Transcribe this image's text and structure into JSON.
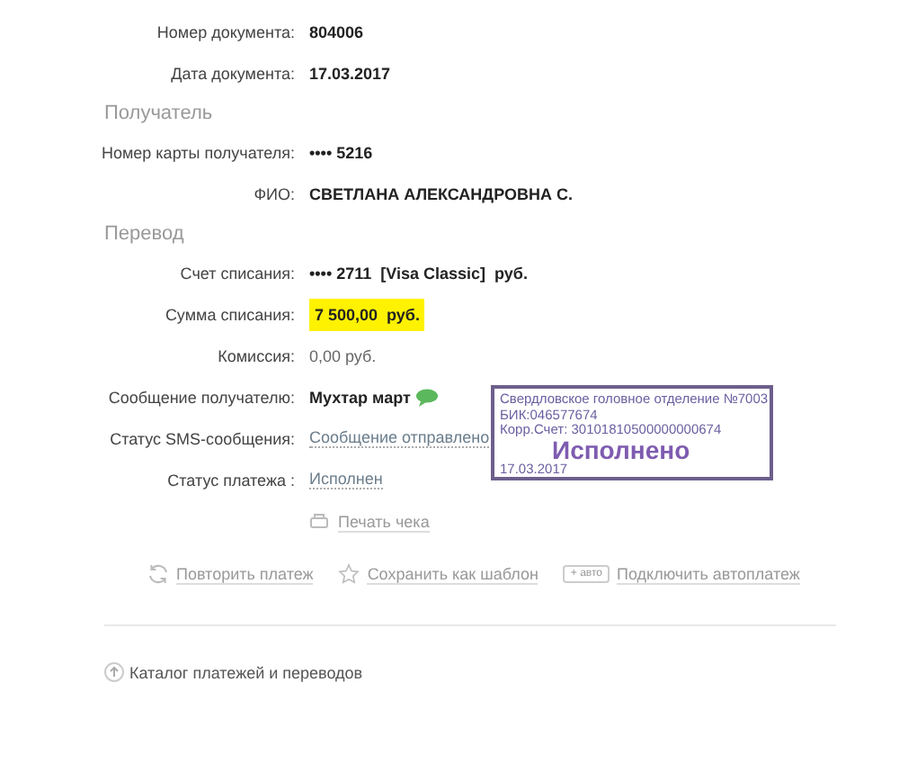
{
  "document": [
    {
      "label": "Номер документа:",
      "value": "804006",
      "kind": "bold"
    },
    {
      "label": "Дата документа:",
      "value": "17.03.2017",
      "kind": "bold"
    }
  ],
  "sections": [
    {
      "title": "Получатель",
      "rows": [
        {
          "label": "Номер карты получателя:",
          "value": "•••• 5216",
          "kind": "bold"
        },
        {
          "label": "ФИО:",
          "value": "СВЕТЛАНА АЛЕКСАНДРОВНА С.",
          "kind": "bold"
        }
      ]
    },
    {
      "title": "Перевод",
      "rows": [
        {
          "label": "Счет списания:",
          "value": "•••• 2711  [Visa Classic]  руб.",
          "kind": "bold"
        },
        {
          "label": "Сумма списания:",
          "value": "7 500,00  руб.",
          "kind": "highlight"
        },
        {
          "label": "Комиссия:",
          "value": "0,00 руб.",
          "kind": "plain"
        },
        {
          "label": "Сообщение получателю:",
          "value": "Мухтар март",
          "kind": "message"
        },
        {
          "label": "Статус SMS-сообщения:",
          "value": "Сообщение отправлено",
          "kind": "link"
        },
        {
          "label": "Статус платежа :",
          "value": "Исполнен",
          "kind": "link"
        }
      ]
    }
  ],
  "print": "Печать чека",
  "actions": [
    {
      "label": "Повторить платеж",
      "kind": "repeat"
    },
    {
      "label": "Сохранить как шаблон",
      "kind": "star"
    },
    {
      "label": "Подключить автоплатеж",
      "kind": "auto",
      "badge": "+ авто"
    }
  ],
  "stamp": {
    "lines": [
      "Свердловское головное отделение №7003",
      "БИК:046577674",
      "Корр.Счет: 30101810500000000674"
    ],
    "status": "Исполнено",
    "date": "17.03.2017"
  },
  "catalog": "Каталог платежей и переводов"
}
